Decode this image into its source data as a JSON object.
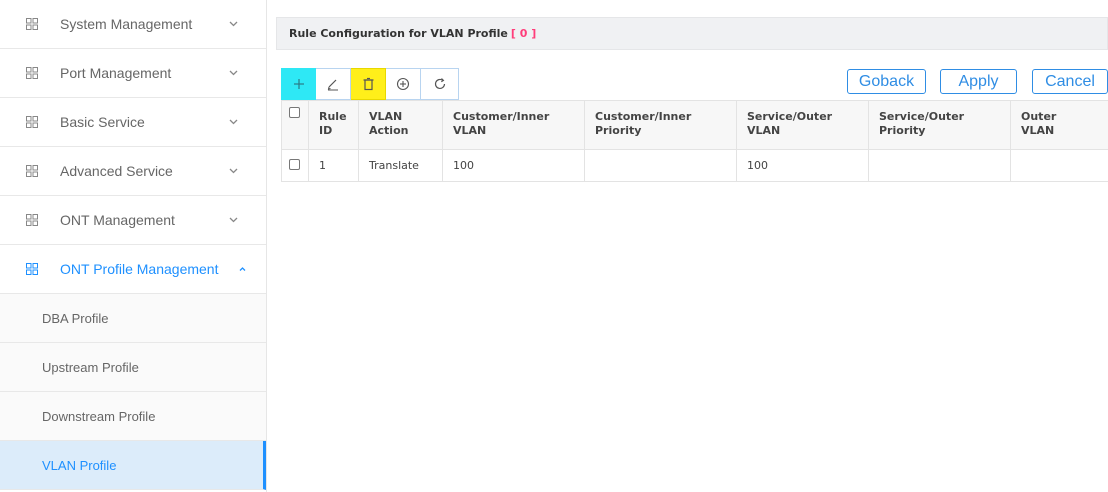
{
  "sidebar": {
    "menus": [
      {
        "label": "System Management",
        "expanded": false
      },
      {
        "label": "Port Management",
        "expanded": false
      },
      {
        "label": "Basic Service",
        "expanded": false
      },
      {
        "label": "Advanced Service",
        "expanded": false
      },
      {
        "label": "ONT Management",
        "expanded": false
      },
      {
        "label": "ONT Profile Management",
        "expanded": true
      }
    ],
    "sub_items": [
      {
        "label": "DBA Profile"
      },
      {
        "label": "Upstream Profile"
      },
      {
        "label": "Downstream Profile"
      },
      {
        "label": "VLAN Profile",
        "active": true
      }
    ],
    "accent_color": "#1e90ff"
  },
  "header": {
    "title": "Rule Configuration for VLAN Profile",
    "count": "[ 0 ]"
  },
  "toolbar": {
    "icons": [
      "plus-icon",
      "edit-icon",
      "trash-icon",
      "circle-plus-icon",
      "refresh-icon"
    ],
    "add_color": "#2ee8f5",
    "delete_color": "#ffef1a",
    "goback_label": "Goback",
    "apply_label": "Apply",
    "cancel_label": "Cancel"
  },
  "table": {
    "columns": [
      {
        "l1": "Rule",
        "l2": "ID"
      },
      {
        "l1": "VLAN",
        "l2": "Action"
      },
      {
        "l1": "Customer/Inner",
        "l2": "VLAN"
      },
      {
        "l1": "Customer/Inner",
        "l2": "Priority"
      },
      {
        "l1": "Service/Outer",
        "l2": "VLAN"
      },
      {
        "l1": "Service/Outer",
        "l2": "Priority"
      },
      {
        "l1": "Outer",
        "l2": "VLAN"
      }
    ],
    "rows": [
      {
        "rule_id": "1",
        "vlan_action": "Translate",
        "customer_inner_vlan": "100",
        "customer_inner_priority": "",
        "service_outer_vlan": "100",
        "service_outer_priority": "",
        "outer_vlan": ""
      }
    ]
  }
}
